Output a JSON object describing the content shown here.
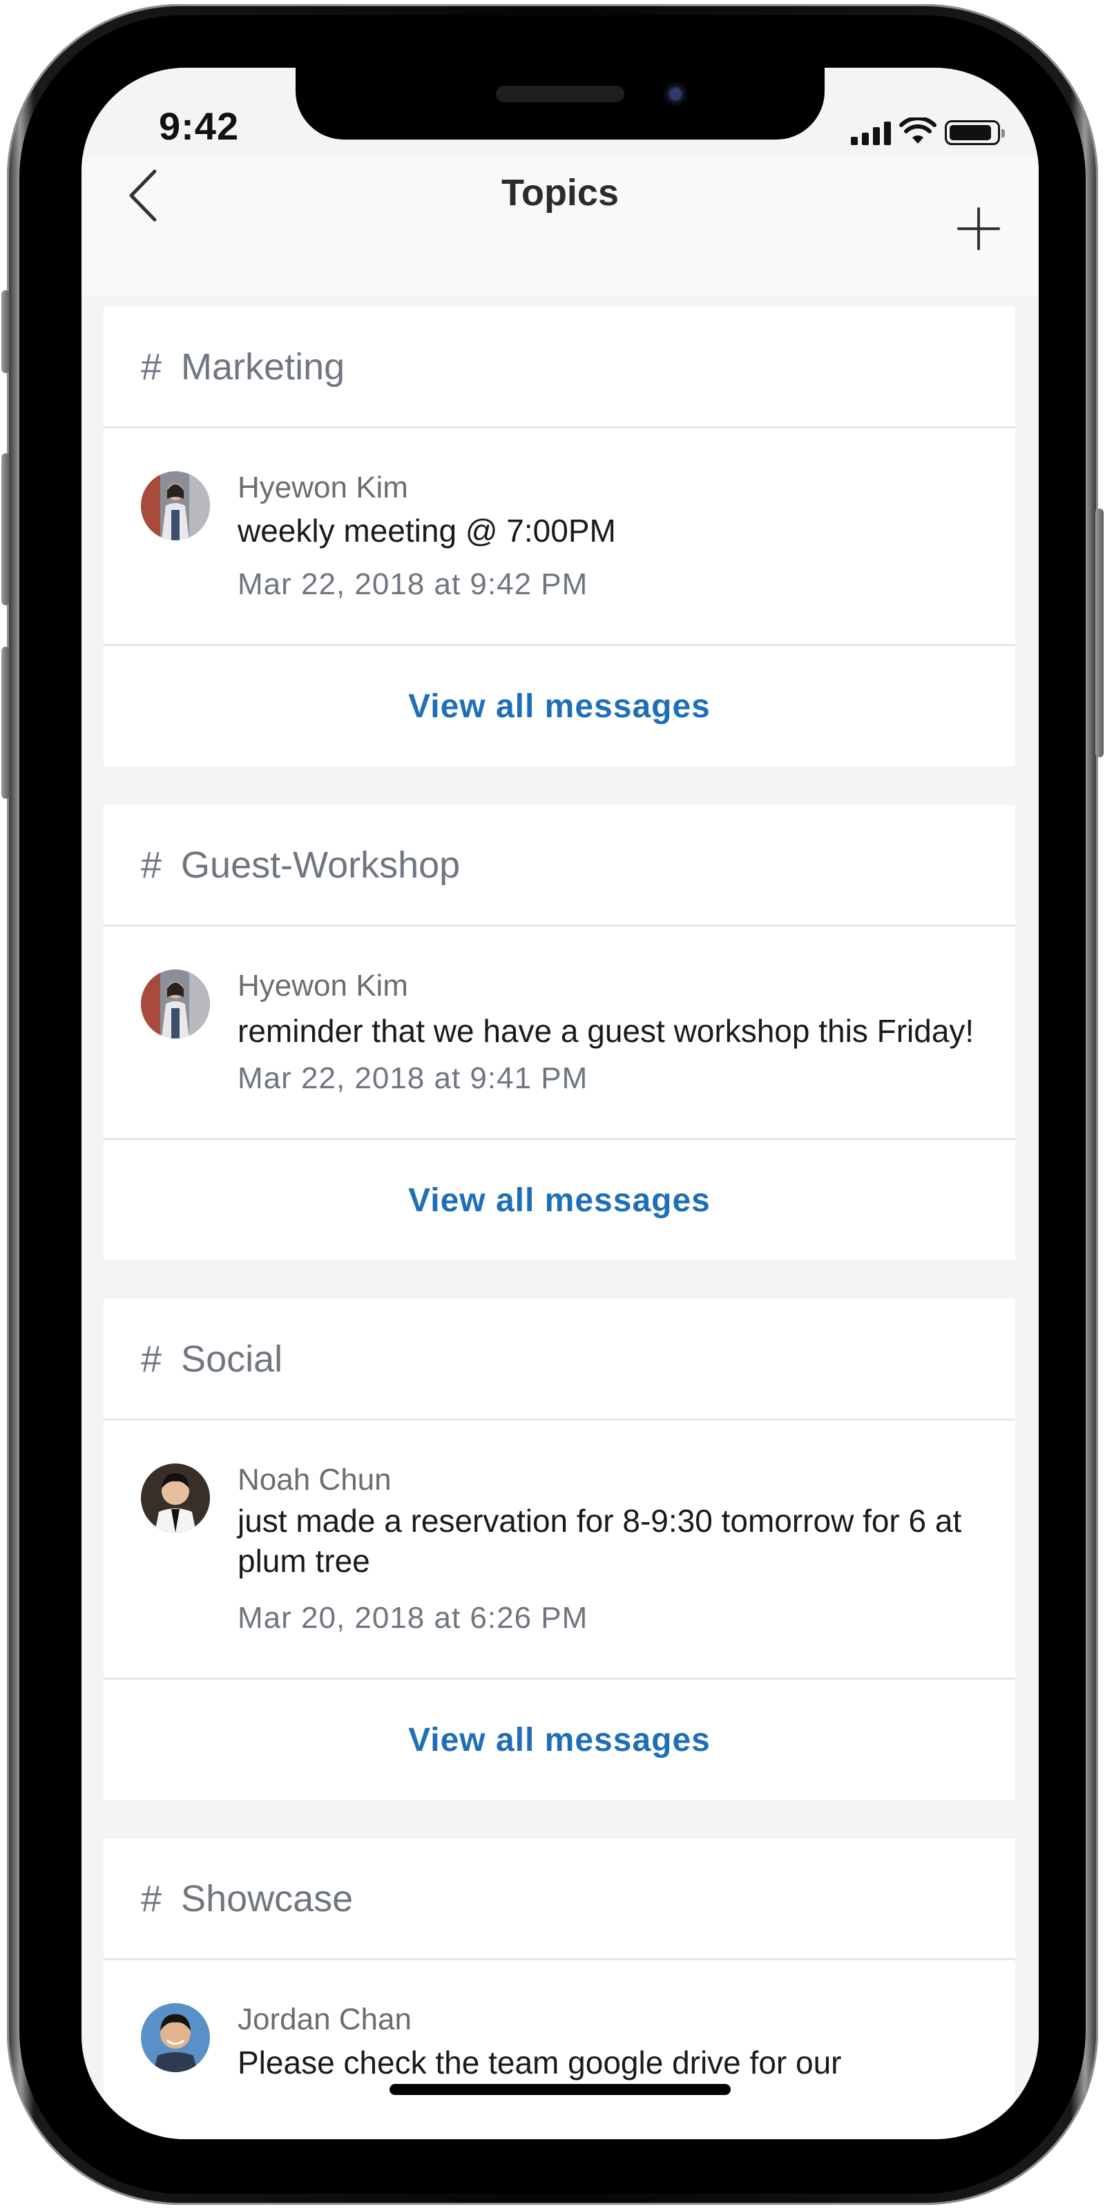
{
  "status": {
    "time": "9:42"
  },
  "nav": {
    "title": "Topics",
    "back_icon": "chevron-left-icon",
    "add_icon": "plus-icon"
  },
  "colors": {
    "link": "#1f6fb8",
    "topic": "#6f7680",
    "background": "#f4f4f4"
  },
  "topics": [
    {
      "hash": "#",
      "name": "Marketing",
      "author": "Hyewon Kim",
      "text": "weekly meeting @ 7:00PM",
      "time": "Mar 22, 2018 at 9:42 PM",
      "view_all": "View all messages"
    },
    {
      "hash": "#",
      "name": "Guest-Workshop",
      "author": "Hyewon Kim",
      "text": "reminder that we have a guest workshop this Friday!",
      "time": "Mar 22, 2018 at 9:41 PM",
      "view_all": "View all messages"
    },
    {
      "hash": "#",
      "name": "Social",
      "author": "Noah Chun",
      "text": "just made a reservation for 8-9:30 tomorrow for 6 at plum tree",
      "time": "Mar 20, 2018 at 6:26 PM",
      "view_all": "View all messages"
    },
    {
      "hash": "#",
      "name": "Showcase",
      "author": "Jordan Chan",
      "text": "Please check the team google drive for our"
    }
  ]
}
